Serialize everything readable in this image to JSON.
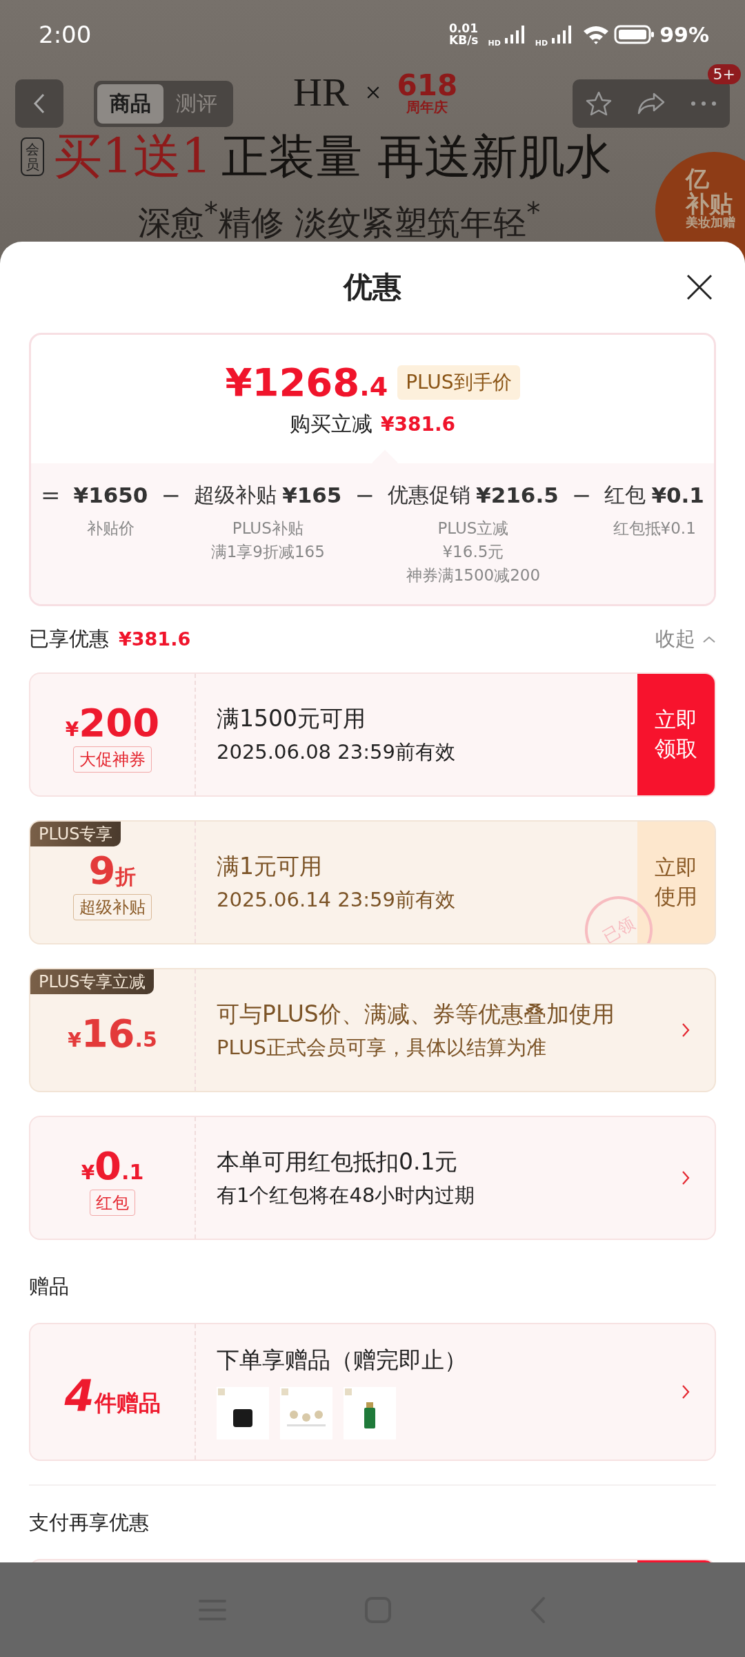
{
  "status_bar": {
    "time": "2:00",
    "net_speed": [
      "0.01",
      "KB/s"
    ],
    "signal_labels": [
      "HD",
      "HD"
    ],
    "battery": "99%"
  },
  "top_bar": {
    "tabs": [
      {
        "label": "商品",
        "selected": true
      },
      {
        "label": "测评",
        "selected": false
      }
    ],
    "brand": "HR",
    "partner": [
      "618",
      "周年庆"
    ],
    "badge": "5+"
  },
  "banner": {
    "tag": "会员",
    "headline_red": "买1送1",
    "headline": "正装量 再送新肌水",
    "subline": "深愈$^{*}$精修 淡纹紧塑筑年轻$^{*}$",
    "corner_badge": [
      "亿",
      "补贴",
      "美妆加赠"
    ]
  },
  "sheet": {
    "title": "优惠"
  },
  "summary": {
    "price_main": "¥1268",
    "price_decimal": ".4",
    "price_tag": "PLUS到手价",
    "saving_label": "购买立减",
    "saving_value": "¥381.6",
    "terms": [
      {
        "op": "=",
        "value": "¥1650",
        "notes": [
          "补贴价"
        ]
      },
      {
        "op": "−",
        "name": "超级补贴",
        "value": "¥165",
        "notes": [
          "PLUS补贴",
          "满1享9折减165"
        ]
      },
      {
        "op": "−",
        "name": "优惠促销",
        "value": "¥216.5",
        "notes": [
          "PLUS立减",
          "¥16.5元",
          "神券满1500减200"
        ]
      },
      {
        "op": "−",
        "name": "红包",
        "value": "¥0.1",
        "notes": [
          "红包抵¥0.1"
        ]
      }
    ]
  },
  "applied": {
    "label": "已享优惠",
    "value": "¥381.6",
    "toggle": "收起",
    "expanded": true
  },
  "offers": [
    {
      "kind": "action",
      "plus": false,
      "currency": "¥",
      "amount": "200",
      "tag": "大促神券",
      "title": "满1500元可用",
      "subtitle": "2025.06.08 23:59前有效",
      "action": "立即领取"
    },
    {
      "kind": "action",
      "plus": true,
      "ribbon": "PLUS专享",
      "amount": "9",
      "unit": "折",
      "tag": "超级补贴",
      "title": "满1元可用",
      "subtitle": "2025.06.14 23:59前有效",
      "action": "立即使用",
      "stamp": "已领"
    },
    {
      "kind": "info",
      "plus": true,
      "ribbon": "PLUS专享立减",
      "currency": "¥",
      "amount": "16",
      "decimal": ".5",
      "title": "可与PLUS价、满减、券等优惠叠加使用",
      "subtitle": "PLUS正式会员可享，具体以结算为准"
    },
    {
      "kind": "info",
      "plus": false,
      "currency": "¥",
      "amount": "0",
      "decimal": ".1",
      "tag": "红包",
      "title": "本单可用红包抵扣0.1元",
      "subtitle": "有1个红包将在48小时内过期"
    }
  ],
  "gifts": {
    "heading": "赠品",
    "count": "4",
    "unit": "件赠品",
    "title": "下单享赠品（赠完即止）"
  },
  "payment": {
    "heading": "支付再享优惠"
  }
}
